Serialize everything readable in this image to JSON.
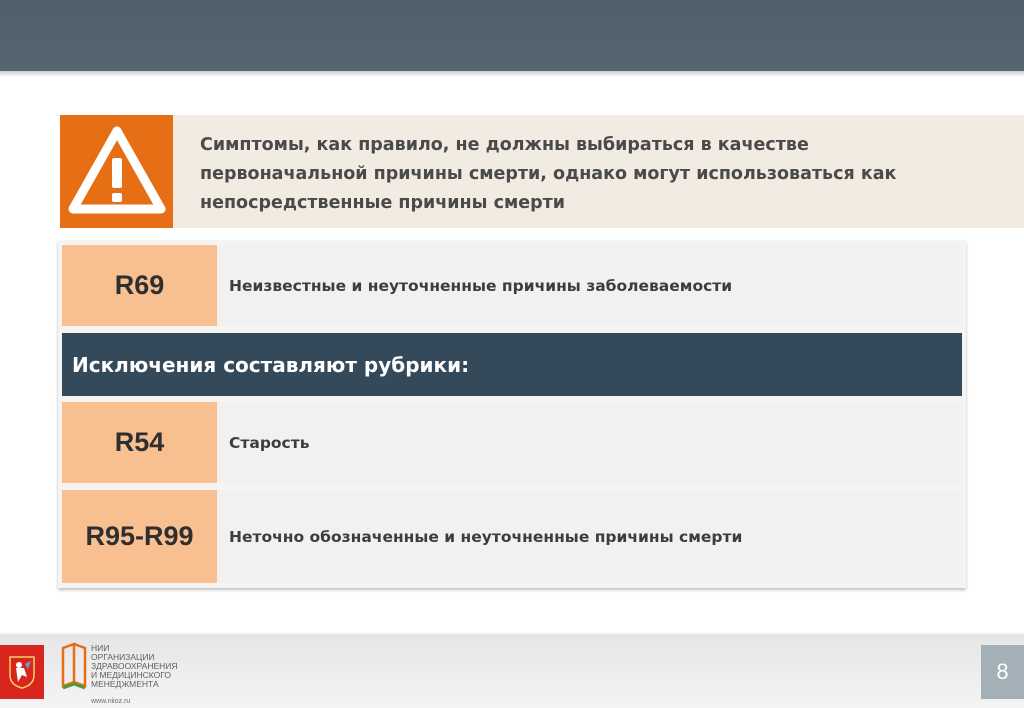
{
  "notice": {
    "icon": "warning-triangle-icon",
    "accent_color": "#e66e14",
    "text": "Симптомы, как правило, не должны выбираться в качестве первоначальной причины смерти, однако могут использоваться как непосредственные причины смерти"
  },
  "rows": [
    {
      "code": "R69",
      "description": "Неизвестные и неуточненные причины заболеваемости"
    },
    {
      "code": "R54",
      "description": "Старость"
    },
    {
      "code": "R95-R99",
      "description": "Неточно обозначенные и неуточненные причины смерти"
    }
  ],
  "exclusions_heading": "Исключения составляют рубрики:",
  "colors": {
    "code_cell": "#f8bf91",
    "heading_bar": "#34495a",
    "top_bar": "#52626d"
  },
  "footer": {
    "emblem": "moscow-coat-of-arms-icon",
    "org_logo": "book-logo-icon",
    "org_lines": [
      "НИИ",
      "ОРГАНИЗАЦИИ",
      "ЗДРАВООХРАНЕНИЯ",
      "И МЕДИЦИНСКОГО",
      "МЕНЕДЖМЕНТА"
    ],
    "org_url": "www.niioz.ru",
    "page_number": "8"
  }
}
